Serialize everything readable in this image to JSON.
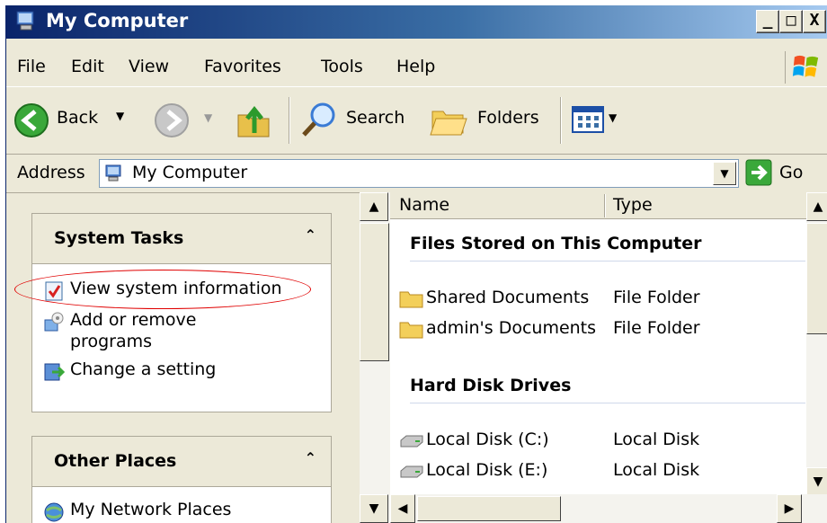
{
  "window": {
    "title": "My Computer",
    "caption_buttons": {
      "minimize": "_",
      "maximize": "□",
      "close": "X"
    }
  },
  "menu": {
    "items": [
      {
        "label": "File"
      },
      {
        "label": "Edit"
      },
      {
        "label": "View"
      },
      {
        "label": "Favorites"
      },
      {
        "label": "Tools"
      },
      {
        "label": "Help"
      }
    ]
  },
  "toolbar": {
    "back_label": "Back",
    "search_label": "Search",
    "folders_label": "Folders"
  },
  "address": {
    "label": "Address",
    "value": "My Computer",
    "go_label": "Go"
  },
  "tasks": {
    "system_tasks_title": "System Tasks",
    "items": [
      {
        "label": "View system information"
      },
      {
        "label": "Add or remove programs"
      },
      {
        "label": "Change a setting"
      }
    ],
    "other_places_title": "Other Places",
    "other_items": [
      {
        "label": "My Network Places"
      }
    ]
  },
  "list": {
    "columns": {
      "name": "Name",
      "type": "Type"
    },
    "groups": [
      {
        "title": "Files Stored on This Computer",
        "rows": [
          {
            "name": "Shared Documents",
            "type": "File Folder"
          },
          {
            "name": "admin's Documents",
            "type": "File Folder"
          }
        ]
      },
      {
        "title": "Hard Disk Drives",
        "rows": [
          {
            "name": "Local Disk (C:)",
            "type": "Local Disk"
          },
          {
            "name": "Local Disk (E:)",
            "type": "Local Disk"
          }
        ]
      }
    ]
  },
  "colors": {
    "titlebar_start": "#0a246a",
    "titlebar_end": "#a6caf0",
    "chrome": "#ece9d8",
    "annotation": "#e00000"
  }
}
